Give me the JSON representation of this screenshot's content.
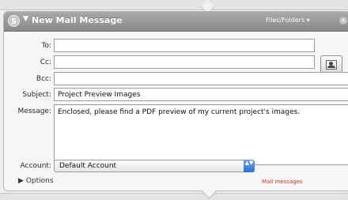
{
  "action": {
    "badge_glyph": "S",
    "disclosure_glyph": "▼",
    "title": "New Mail Message",
    "files_folders": "Files/Folders ▾",
    "close_glyph": "×"
  },
  "form": {
    "to_label": "To:",
    "to_value": "",
    "cc_label": "Cc:",
    "cc_value": "",
    "bcc_label": "Bcc:",
    "bcc_value": "",
    "subject_label": "Subject:",
    "subject_value": "Project Preview Images",
    "message_label": "Message:",
    "message_value": "Enclosed, please find a PDF preview of my current project's images.",
    "account_label": "Account:",
    "account_value": "Default Account",
    "select_arrows": "▲▼"
  },
  "footer": {
    "options_label": "▶ Options",
    "mail_link": "Mail messages"
  }
}
